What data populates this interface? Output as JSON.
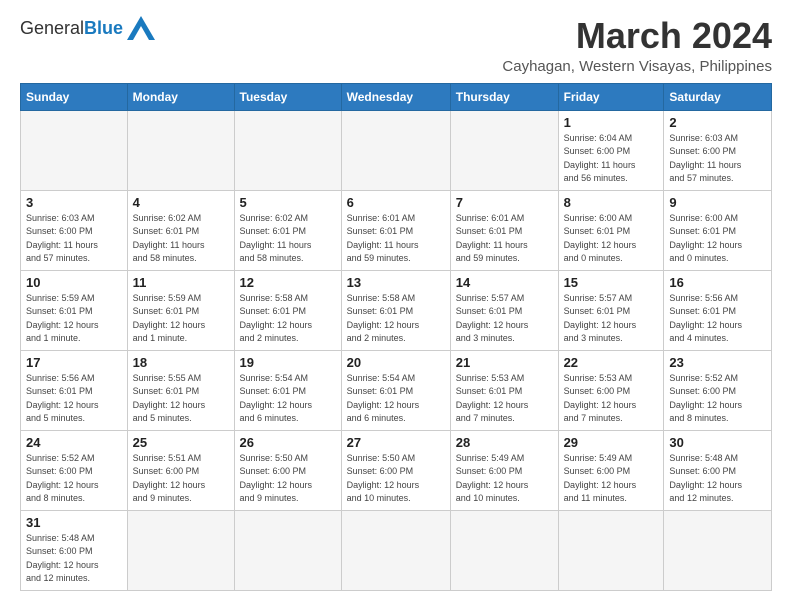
{
  "header": {
    "logo_general": "General",
    "logo_blue": "Blue",
    "month_title": "March 2024",
    "location": "Cayhagan, Western Visayas, Philippines"
  },
  "weekdays": [
    "Sunday",
    "Monday",
    "Tuesday",
    "Wednesday",
    "Thursday",
    "Friday",
    "Saturday"
  ],
  "weeks": [
    [
      {
        "day": "",
        "info": ""
      },
      {
        "day": "",
        "info": ""
      },
      {
        "day": "",
        "info": ""
      },
      {
        "day": "",
        "info": ""
      },
      {
        "day": "",
        "info": ""
      },
      {
        "day": "1",
        "info": "Sunrise: 6:04 AM\nSunset: 6:00 PM\nDaylight: 11 hours\nand 56 minutes."
      },
      {
        "day": "2",
        "info": "Sunrise: 6:03 AM\nSunset: 6:00 PM\nDaylight: 11 hours\nand 57 minutes."
      }
    ],
    [
      {
        "day": "3",
        "info": "Sunrise: 6:03 AM\nSunset: 6:00 PM\nDaylight: 11 hours\nand 57 minutes."
      },
      {
        "day": "4",
        "info": "Sunrise: 6:02 AM\nSunset: 6:01 PM\nDaylight: 11 hours\nand 58 minutes."
      },
      {
        "day": "5",
        "info": "Sunrise: 6:02 AM\nSunset: 6:01 PM\nDaylight: 11 hours\nand 58 minutes."
      },
      {
        "day": "6",
        "info": "Sunrise: 6:01 AM\nSunset: 6:01 PM\nDaylight: 11 hours\nand 59 minutes."
      },
      {
        "day": "7",
        "info": "Sunrise: 6:01 AM\nSunset: 6:01 PM\nDaylight: 11 hours\nand 59 minutes."
      },
      {
        "day": "8",
        "info": "Sunrise: 6:00 AM\nSunset: 6:01 PM\nDaylight: 12 hours\nand 0 minutes."
      },
      {
        "day": "9",
        "info": "Sunrise: 6:00 AM\nSunset: 6:01 PM\nDaylight: 12 hours\nand 0 minutes."
      }
    ],
    [
      {
        "day": "10",
        "info": "Sunrise: 5:59 AM\nSunset: 6:01 PM\nDaylight: 12 hours\nand 1 minute."
      },
      {
        "day": "11",
        "info": "Sunrise: 5:59 AM\nSunset: 6:01 PM\nDaylight: 12 hours\nand 1 minute."
      },
      {
        "day": "12",
        "info": "Sunrise: 5:58 AM\nSunset: 6:01 PM\nDaylight: 12 hours\nand 2 minutes."
      },
      {
        "day": "13",
        "info": "Sunrise: 5:58 AM\nSunset: 6:01 PM\nDaylight: 12 hours\nand 2 minutes."
      },
      {
        "day": "14",
        "info": "Sunrise: 5:57 AM\nSunset: 6:01 PM\nDaylight: 12 hours\nand 3 minutes."
      },
      {
        "day": "15",
        "info": "Sunrise: 5:57 AM\nSunset: 6:01 PM\nDaylight: 12 hours\nand 3 minutes."
      },
      {
        "day": "16",
        "info": "Sunrise: 5:56 AM\nSunset: 6:01 PM\nDaylight: 12 hours\nand 4 minutes."
      }
    ],
    [
      {
        "day": "17",
        "info": "Sunrise: 5:56 AM\nSunset: 6:01 PM\nDaylight: 12 hours\nand 5 minutes."
      },
      {
        "day": "18",
        "info": "Sunrise: 5:55 AM\nSunset: 6:01 PM\nDaylight: 12 hours\nand 5 minutes."
      },
      {
        "day": "19",
        "info": "Sunrise: 5:54 AM\nSunset: 6:01 PM\nDaylight: 12 hours\nand 6 minutes."
      },
      {
        "day": "20",
        "info": "Sunrise: 5:54 AM\nSunset: 6:01 PM\nDaylight: 12 hours\nand 6 minutes."
      },
      {
        "day": "21",
        "info": "Sunrise: 5:53 AM\nSunset: 6:01 PM\nDaylight: 12 hours\nand 7 minutes."
      },
      {
        "day": "22",
        "info": "Sunrise: 5:53 AM\nSunset: 6:00 PM\nDaylight: 12 hours\nand 7 minutes."
      },
      {
        "day": "23",
        "info": "Sunrise: 5:52 AM\nSunset: 6:00 PM\nDaylight: 12 hours\nand 8 minutes."
      }
    ],
    [
      {
        "day": "24",
        "info": "Sunrise: 5:52 AM\nSunset: 6:00 PM\nDaylight: 12 hours\nand 8 minutes."
      },
      {
        "day": "25",
        "info": "Sunrise: 5:51 AM\nSunset: 6:00 PM\nDaylight: 12 hours\nand 9 minutes."
      },
      {
        "day": "26",
        "info": "Sunrise: 5:50 AM\nSunset: 6:00 PM\nDaylight: 12 hours\nand 9 minutes."
      },
      {
        "day": "27",
        "info": "Sunrise: 5:50 AM\nSunset: 6:00 PM\nDaylight: 12 hours\nand 10 minutes."
      },
      {
        "day": "28",
        "info": "Sunrise: 5:49 AM\nSunset: 6:00 PM\nDaylight: 12 hours\nand 10 minutes."
      },
      {
        "day": "29",
        "info": "Sunrise: 5:49 AM\nSunset: 6:00 PM\nDaylight: 12 hours\nand 11 minutes."
      },
      {
        "day": "30",
        "info": "Sunrise: 5:48 AM\nSunset: 6:00 PM\nDaylight: 12 hours\nand 12 minutes."
      }
    ],
    [
      {
        "day": "31",
        "info": "Sunrise: 5:48 AM\nSunset: 6:00 PM\nDaylight: 12 hours\nand 12 minutes."
      },
      {
        "day": "",
        "info": ""
      },
      {
        "day": "",
        "info": ""
      },
      {
        "day": "",
        "info": ""
      },
      {
        "day": "",
        "info": ""
      },
      {
        "day": "",
        "info": ""
      },
      {
        "day": "",
        "info": ""
      }
    ]
  ]
}
